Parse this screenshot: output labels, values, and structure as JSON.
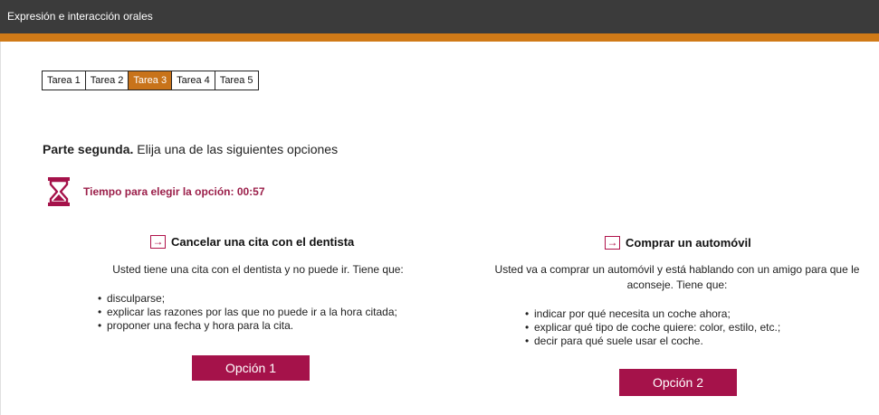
{
  "header": {
    "title": "Expresión e interacción orales"
  },
  "tabs": [
    {
      "label": "Tarea 1",
      "active": false
    },
    {
      "label": "Tarea 2",
      "active": false
    },
    {
      "label": "Tarea 3",
      "active": true
    },
    {
      "label": "Tarea 4",
      "active": false
    },
    {
      "label": "Tarea 5",
      "active": false
    }
  ],
  "instructions": {
    "bold": "Parte segunda.",
    "text": " Elija una de las siguientes opciones"
  },
  "timer": {
    "icon": "hourglass-icon",
    "text": "Tiempo para elegir la opción: 00:57"
  },
  "options": [
    {
      "title": "Cancelar una cita con el dentista",
      "description": "Usted tiene una cita con el dentista y no puede ir. Tiene que:",
      "bullets": [
        "disculparse;",
        "explicar las razones por las que no puede ir a la hora citada;",
        "proponer una fecha y hora para la cita."
      ],
      "button": "Opción 1"
    },
    {
      "title": "Comprar un automóvil",
      "description_line1": "Usted va a comprar un automóvil y está hablando con un amigo para que le",
      "description_line2": "aconseje. Tiene que:",
      "bullets": [
        "indicar por qué necesita un coche ahora;",
        "explicar qué tipo de coche quiere: color, estilo, etc.;",
        "decir para qué suele usar el coche."
      ],
      "button": "Opción 2"
    }
  ],
  "colors": {
    "accent_orange": "#d07a17",
    "brand_red": "#a5124a",
    "topbar": "#3b3b3b"
  }
}
